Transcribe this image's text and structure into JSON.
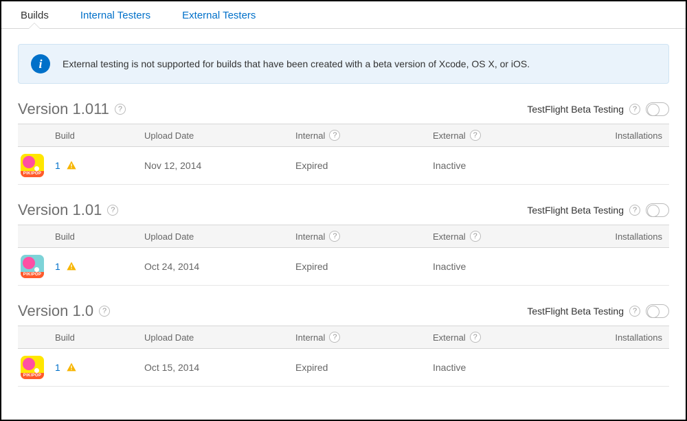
{
  "tabs": {
    "builds": "Builds",
    "internal": "Internal Testers",
    "external": "External Testers"
  },
  "banner": {
    "text": "External testing is not supported for builds that have been created with a beta version of Xcode, OS X, or iOS."
  },
  "columns": {
    "build": "Build",
    "upload": "Upload Date",
    "internal": "Internal",
    "external": "External",
    "installs": "Installations"
  },
  "beta_label": "TestFlight Beta Testing",
  "versions": [
    {
      "title": "Version 1.011",
      "icon_variant": "yellow",
      "build": "1",
      "upload": "Nov 12, 2014",
      "internal": "Expired",
      "external": "Inactive",
      "installs": ""
    },
    {
      "title": "Version 1.01",
      "icon_variant": "teal",
      "build": "1",
      "upload": "Oct 24, 2014",
      "internal": "Expired",
      "external": "Inactive",
      "installs": ""
    },
    {
      "title": "Version 1.0",
      "icon_variant": "yellow",
      "build": "1",
      "upload": "Oct 15, 2014",
      "internal": "Expired",
      "external": "Inactive",
      "installs": ""
    }
  ]
}
